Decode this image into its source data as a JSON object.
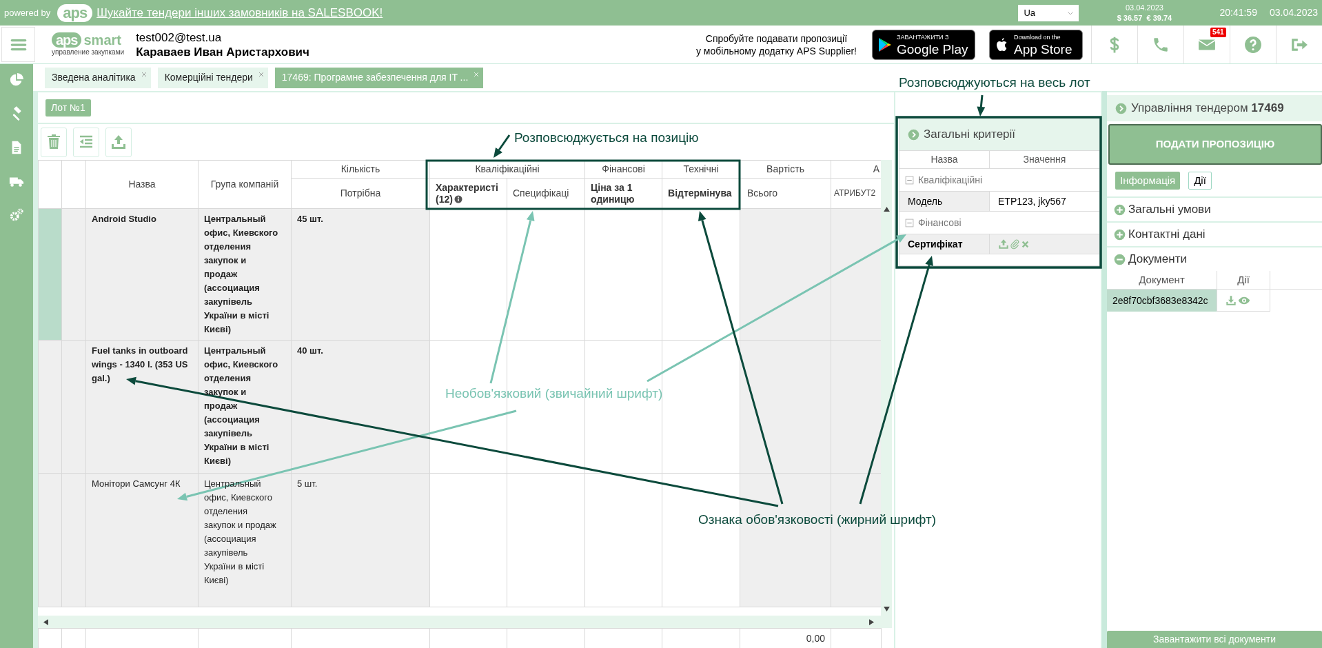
{
  "top_bar": {
    "powered_by": "powered by",
    "logo": "aps",
    "link": "Шукайте тендери інших замовників на SALESBOOK!",
    "language": "Ua",
    "rates_date": "03.04.2023",
    "rates": "$ 36.57  € 39.74",
    "time": "20:41:59",
    "date": "03.04.2023"
  },
  "header": {
    "logo_mark": "aps",
    "logo_word": "smart",
    "logo_tagline": "управление закупками",
    "email": "test002@test.ua",
    "user_name": "Караваев Иван Аристархович",
    "mobile_promo": [
      "Спробуйте подавати пропозиції",
      "у мобільному додатку APS Supplier!"
    ],
    "store_badges": [
      {
        "kind": "google",
        "small": "ЗАВАНТАЖИТИ З",
        "big": "Google Play"
      },
      {
        "kind": "apple",
        "small": "Download on the",
        "big": "App Store"
      }
    ],
    "buttons": [
      {
        "kind": "dollar"
      },
      {
        "kind": "phone"
      },
      {
        "kind": "mail",
        "badge": "541"
      },
      {
        "kind": "help"
      },
      {
        "kind": "logout"
      }
    ]
  },
  "sidebar": [
    {
      "kind": "chart"
    },
    {
      "kind": "gavel"
    },
    {
      "kind": "document"
    },
    {
      "kind": "truck"
    },
    {
      "kind": "gears"
    }
  ],
  "tabs": [
    {
      "label": "Зведена аналітика",
      "selected": false
    },
    {
      "label": "Комерційні тендери",
      "selected": false
    },
    {
      "label": "17469: Програмне забезпечення для IT ...",
      "selected": true
    }
  ],
  "lot_button": "Лот №1",
  "toolbar": [
    {
      "kind": "delete"
    },
    {
      "kind": "outdent"
    },
    {
      "kind": "upload"
    }
  ],
  "table": {
    "columns": [
      {
        "label": "Назва"
      },
      {
        "label": "Група компаній"
      },
      {
        "group": "Кількість",
        "columns": [
          {
            "label": "Потрібна",
            "kind": "quantity",
            "required": false,
            "info": false
          }
        ]
      },
      {
        "group": "Кваліфікаційні",
        "columns": [
          {
            "label": "Характеристі (12)",
            "kind": "criterion",
            "required": true,
            "info": true
          },
          {
            "label": "Специфікаці",
            "kind": "criterion",
            "required": false,
            "info": false
          }
        ]
      },
      {
        "group": "Фінансові",
        "columns": [
          {
            "label": "Ціна за 1 одиницю",
            "kind": "criterion",
            "required": true,
            "info": false
          }
        ]
      },
      {
        "group": "Технічні",
        "columns": [
          {
            "label": "Відтермінува",
            "kind": "criterion",
            "required": true,
            "info": false
          }
        ]
      },
      {
        "group": "Вартість",
        "columns": [
          {
            "label": "Всього",
            "kind": "total",
            "required": false,
            "info": false
          }
        ]
      },
      {
        "group": "А",
        "columns": [
          {
            "label": "АТРИБУТ2",
            "kind": "attribute",
            "required": false,
            "info": false
          }
        ]
      }
    ],
    "rows": [
      {
        "name": "Android Studio",
        "group": "Центральный офис, Киевского отделения закупок и продаж (ассоциация закупівель України в місті Києві)",
        "quantity": "45 шт.",
        "required": true,
        "selected": true
      },
      {
        "name": "Fuel tanks in outboard wings - 1340 l. (353 US gal.)",
        "group": "Центральный офис, Киевского отделения закупок и продаж (ассоциация закупівель України в місті Києві)",
        "quantity": "40 шт.",
        "required": true,
        "selected": false
      },
      {
        "name": "Монітори Самсунг 4К",
        "group": "Центральный офис, Киевского отделения закупок и продаж (ассоциация закупівель України в місті Києві)",
        "quantity": "5 шт.",
        "required": false,
        "selected": false
      }
    ],
    "footer_total": "0,00"
  },
  "criteria": {
    "title": "Загальні критерії",
    "columns": [
      "Назва",
      "Значення"
    ],
    "groups": [
      {
        "label": "Кваліфікаційні",
        "expanded": true,
        "rows": [
          {
            "kind": "text",
            "name": "Модель",
            "value": "ETP123, jky567",
            "required": false
          }
        ]
      },
      {
        "label": "Фінансові",
        "expanded": true,
        "rows": [
          {
            "kind": "file",
            "name": "Сертифікат",
            "required": true
          }
        ]
      }
    ]
  },
  "tender_panel": {
    "title": "Управління тендером **17469**",
    "submit": "ПОДАТИ ПРОПОЗИЦІЮ",
    "tabs": [
      {
        "label": "Інформація",
        "selected": true
      },
      {
        "label": "Дії",
        "selected": false
      }
    ],
    "sections": [
      {
        "label": "Загальні умови",
        "expanded": false
      },
      {
        "label": "Контактні дані",
        "expanded": false
      },
      {
        "label": "Документи",
        "expanded": true
      }
    ],
    "documents": {
      "columns": [
        "Документ",
        "Дії"
      ],
      "rows": [
        {
          "name": "2e8f70cbf3683e8342c"
        }
      ]
    },
    "download_all": "Завантажити всі документи"
  },
  "annotations": [
    {
      "text": "Розповсюджується на позицію",
      "kind": "required"
    },
    {
      "text": "Розповсюджуються на весь лот",
      "kind": "required"
    },
    {
      "text": "Необов'язковий (звичайний шрифт)",
      "kind": "optional"
    },
    {
      "text": "Ознака обов'язковості (жирний шрифт)",
      "kind": "required"
    }
  ]
}
